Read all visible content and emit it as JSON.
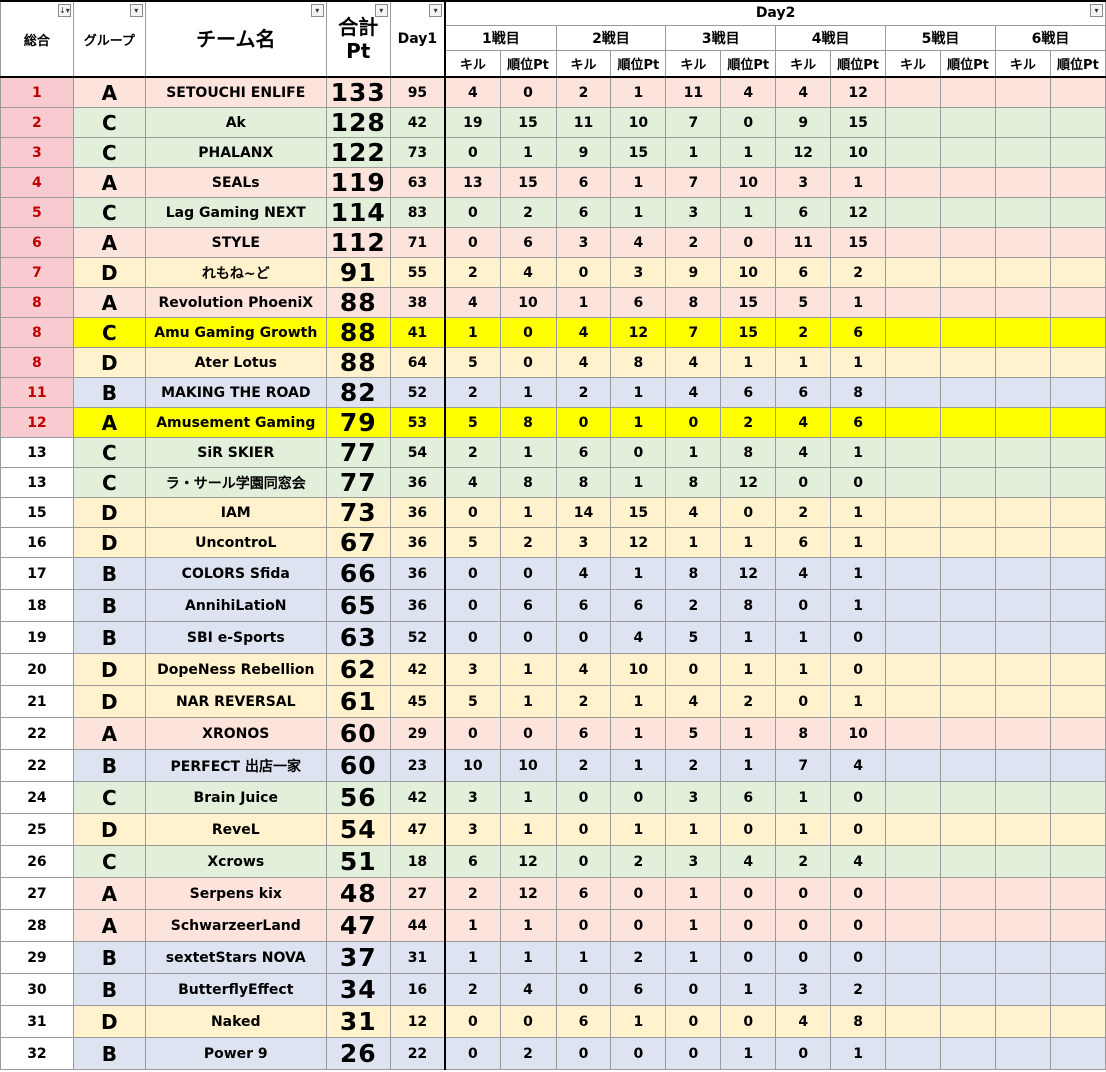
{
  "header": {
    "rank": "総合",
    "group": "グループ",
    "team": "チーム名",
    "total_line1": "合計",
    "total_line2": "Pt",
    "day1": "Day1",
    "day2": "Day2",
    "battles": [
      "1戦目",
      "2戦目",
      "3戦目",
      "4戦目",
      "5戦目",
      "6戦目"
    ],
    "kill_label": "キル",
    "place_label": "順位Pt"
  },
  "colors": {
    "group_A": "#fce4dc",
    "group_B": "#dde3f0",
    "group_C": "#e2efda",
    "group_D": "#fff2cc",
    "highlight": "#ffff00",
    "top_rank_bg": "#f8cbd0",
    "top_rank_text": "#c00000"
  },
  "rows": [
    {
      "rank": "1",
      "group": "A",
      "team": "SETOUCHI ENLIFE",
      "pt": "133",
      "day1": "95",
      "g": [
        "4",
        "0",
        "2",
        "1",
        "11",
        "4",
        "4",
        "12",
        "",
        "",
        "",
        ""
      ],
      "top": true,
      "hl": false
    },
    {
      "rank": "2",
      "group": "C",
      "team": "Ak",
      "pt": "128",
      "day1": "42",
      "g": [
        "19",
        "15",
        "11",
        "10",
        "7",
        "0",
        "9",
        "15",
        "",
        "",
        "",
        ""
      ],
      "top": true,
      "hl": false
    },
    {
      "rank": "3",
      "group": "C",
      "team": "PHALANX",
      "pt": "122",
      "day1": "73",
      "g": [
        "0",
        "1",
        "9",
        "15",
        "1",
        "1",
        "12",
        "10",
        "",
        "",
        "",
        ""
      ],
      "top": true,
      "hl": false
    },
    {
      "rank": "4",
      "group": "A",
      "team": "SEALs",
      "pt": "119",
      "day1": "63",
      "g": [
        "13",
        "15",
        "6",
        "1",
        "7",
        "10",
        "3",
        "1",
        "",
        "",
        "",
        ""
      ],
      "top": true,
      "hl": false
    },
    {
      "rank": "5",
      "group": "C",
      "team": "Lag Gaming NEXT",
      "pt": "114",
      "day1": "83",
      "g": [
        "0",
        "2",
        "6",
        "1",
        "3",
        "1",
        "6",
        "12",
        "",
        "",
        "",
        ""
      ],
      "top": true,
      "hl": false
    },
    {
      "rank": "6",
      "group": "A",
      "team": "STYLE",
      "pt": "112",
      "day1": "71",
      "g": [
        "0",
        "6",
        "3",
        "4",
        "2",
        "0",
        "11",
        "15",
        "",
        "",
        "",
        ""
      ],
      "top": true,
      "hl": false
    },
    {
      "rank": "7",
      "group": "D",
      "team": "れもね~ど",
      "pt": "91",
      "day1": "55",
      "g": [
        "2",
        "4",
        "0",
        "3",
        "9",
        "10",
        "6",
        "2",
        "",
        "",
        "",
        ""
      ],
      "top": true,
      "hl": false
    },
    {
      "rank": "8",
      "group": "A",
      "team": "Revolution PhoeniX",
      "pt": "88",
      "day1": "38",
      "g": [
        "4",
        "10",
        "1",
        "6",
        "8",
        "15",
        "5",
        "1",
        "",
        "",
        "",
        ""
      ],
      "top": true,
      "hl": false
    },
    {
      "rank": "8",
      "group": "C",
      "team": "Amu Gaming Growth",
      "pt": "88",
      "day1": "41",
      "g": [
        "1",
        "0",
        "4",
        "12",
        "7",
        "15",
        "2",
        "6",
        "",
        "",
        "",
        ""
      ],
      "top": true,
      "hl": true
    },
    {
      "rank": "8",
      "group": "D",
      "team": "Ater Lotus",
      "pt": "88",
      "day1": "64",
      "g": [
        "5",
        "0",
        "4",
        "8",
        "4",
        "1",
        "1",
        "1",
        "",
        "",
        "",
        ""
      ],
      "top": true,
      "hl": false
    },
    {
      "rank": "11",
      "group": "B",
      "team": "MAKING THE ROAD",
      "pt": "82",
      "day1": "52",
      "g": [
        "2",
        "1",
        "2",
        "1",
        "4",
        "6",
        "6",
        "8",
        "",
        "",
        "",
        ""
      ],
      "top": true,
      "hl": false
    },
    {
      "rank": "12",
      "group": "A",
      "team": "Amusement Gaming",
      "pt": "79",
      "day1": "53",
      "g": [
        "5",
        "8",
        "0",
        "1",
        "0",
        "2",
        "4",
        "6",
        "",
        "",
        "",
        ""
      ],
      "top": true,
      "hl": true
    },
    {
      "rank": "13",
      "group": "C",
      "team": "SiR SKIER",
      "pt": "77",
      "day1": "54",
      "g": [
        "2",
        "1",
        "6",
        "0",
        "1",
        "8",
        "4",
        "1",
        "",
        "",
        "",
        ""
      ],
      "top": false,
      "hl": false
    },
    {
      "rank": "13",
      "group": "C",
      "team": "ラ・サール学園同窓会",
      "pt": "77",
      "day1": "36",
      "g": [
        "4",
        "8",
        "8",
        "1",
        "8",
        "12",
        "0",
        "0",
        "",
        "",
        "",
        ""
      ],
      "top": false,
      "hl": false
    },
    {
      "rank": "15",
      "group": "D",
      "team": "IAM",
      "pt": "73",
      "day1": "36",
      "g": [
        "0",
        "1",
        "14",
        "15",
        "4",
        "0",
        "2",
        "1",
        "",
        "",
        "",
        ""
      ],
      "top": false,
      "hl": false
    },
    {
      "rank": "16",
      "group": "D",
      "team": "UncontroL",
      "pt": "67",
      "day1": "36",
      "g": [
        "5",
        "2",
        "3",
        "12",
        "1",
        "1",
        "6",
        "1",
        "",
        "",
        "",
        ""
      ],
      "top": false,
      "hl": false
    },
    {
      "rank": "17",
      "group": "B",
      "team": "COLORS Sfida",
      "pt": "66",
      "day1": "36",
      "g": [
        "0",
        "0",
        "4",
        "1",
        "8",
        "12",
        "4",
        "1",
        "",
        "",
        "",
        ""
      ],
      "top": false,
      "hl": false
    },
    {
      "rank": "18",
      "group": "B",
      "team": "AnnihiLatioN",
      "pt": "65",
      "day1": "36",
      "g": [
        "0",
        "6",
        "6",
        "6",
        "2",
        "8",
        "0",
        "1",
        "",
        "",
        "",
        ""
      ],
      "top": false,
      "hl": false
    },
    {
      "rank": "19",
      "group": "B",
      "team": "SBI e-Sports",
      "pt": "63",
      "day1": "52",
      "g": [
        "0",
        "0",
        "0",
        "4",
        "5",
        "1",
        "1",
        "0",
        "",
        "",
        "",
        ""
      ],
      "top": false,
      "hl": false
    },
    {
      "rank": "20",
      "group": "D",
      "team": "DopeNess Rebellion",
      "pt": "62",
      "day1": "42",
      "g": [
        "3",
        "1",
        "4",
        "10",
        "0",
        "1",
        "1",
        "0",
        "",
        "",
        "",
        ""
      ],
      "top": false,
      "hl": false
    },
    {
      "rank": "21",
      "group": "D",
      "team": "NAR REVERSAL",
      "pt": "61",
      "day1": "45",
      "g": [
        "5",
        "1",
        "2",
        "1",
        "4",
        "2",
        "0",
        "1",
        "",
        "",
        "",
        ""
      ],
      "top": false,
      "hl": false
    },
    {
      "rank": "22",
      "group": "A",
      "team": "XRONOS",
      "pt": "60",
      "day1": "29",
      "g": [
        "0",
        "0",
        "6",
        "1",
        "5",
        "1",
        "8",
        "10",
        "",
        "",
        "",
        ""
      ],
      "top": false,
      "hl": false
    },
    {
      "rank": "22",
      "group": "B",
      "team": "PERFECT 出店一家",
      "pt": "60",
      "day1": "23",
      "g": [
        "10",
        "10",
        "2",
        "1",
        "2",
        "1",
        "7",
        "4",
        "",
        "",
        "",
        ""
      ],
      "top": false,
      "hl": false
    },
    {
      "rank": "24",
      "group": "C",
      "team": "Brain Juice",
      "pt": "56",
      "day1": "42",
      "g": [
        "3",
        "1",
        "0",
        "0",
        "3",
        "6",
        "1",
        "0",
        "",
        "",
        "",
        ""
      ],
      "top": false,
      "hl": false
    },
    {
      "rank": "25",
      "group": "D",
      "team": "ReveL",
      "pt": "54",
      "day1": "47",
      "g": [
        "3",
        "1",
        "0",
        "1",
        "1",
        "0",
        "1",
        "0",
        "",
        "",
        "",
        ""
      ],
      "top": false,
      "hl": false
    },
    {
      "rank": "26",
      "group": "C",
      "team": "Xcrows",
      "pt": "51",
      "day1": "18",
      "g": [
        "6",
        "12",
        "0",
        "2",
        "3",
        "4",
        "2",
        "4",
        "",
        "",
        "",
        ""
      ],
      "top": false,
      "hl": false
    },
    {
      "rank": "27",
      "group": "A",
      "team": "Serpens kix",
      "pt": "48",
      "day1": "27",
      "g": [
        "2",
        "12",
        "6",
        "0",
        "1",
        "0",
        "0",
        "0",
        "",
        "",
        "",
        ""
      ],
      "top": false,
      "hl": false
    },
    {
      "rank": "28",
      "group": "A",
      "team": "SchwarzeerLand",
      "pt": "47",
      "day1": "44",
      "g": [
        "1",
        "1",
        "0",
        "0",
        "1",
        "0",
        "0",
        "0",
        "",
        "",
        "",
        ""
      ],
      "top": false,
      "hl": false
    },
    {
      "rank": "29",
      "group": "B",
      "team": "sextetStars NOVA",
      "pt": "37",
      "day1": "31",
      "g": [
        "1",
        "1",
        "1",
        "2",
        "1",
        "0",
        "0",
        "0",
        "",
        "",
        "",
        ""
      ],
      "top": false,
      "hl": false
    },
    {
      "rank": "30",
      "group": "B",
      "team": "ButterflyEffect",
      "pt": "34",
      "day1": "16",
      "g": [
        "2",
        "4",
        "0",
        "6",
        "0",
        "1",
        "3",
        "2",
        "",
        "",
        "",
        ""
      ],
      "top": false,
      "hl": false
    },
    {
      "rank": "31",
      "group": "D",
      "team": "Naked",
      "pt": "31",
      "day1": "12",
      "g": [
        "0",
        "0",
        "6",
        "1",
        "0",
        "0",
        "4",
        "8",
        "",
        "",
        "",
        ""
      ],
      "top": false,
      "hl": false
    },
    {
      "rank": "32",
      "group": "B",
      "team": "Power 9",
      "pt": "26",
      "day1": "22",
      "g": [
        "0",
        "2",
        "0",
        "0",
        "0",
        "1",
        "0",
        "1",
        "",
        "",
        "",
        ""
      ],
      "top": false,
      "hl": false
    }
  ]
}
